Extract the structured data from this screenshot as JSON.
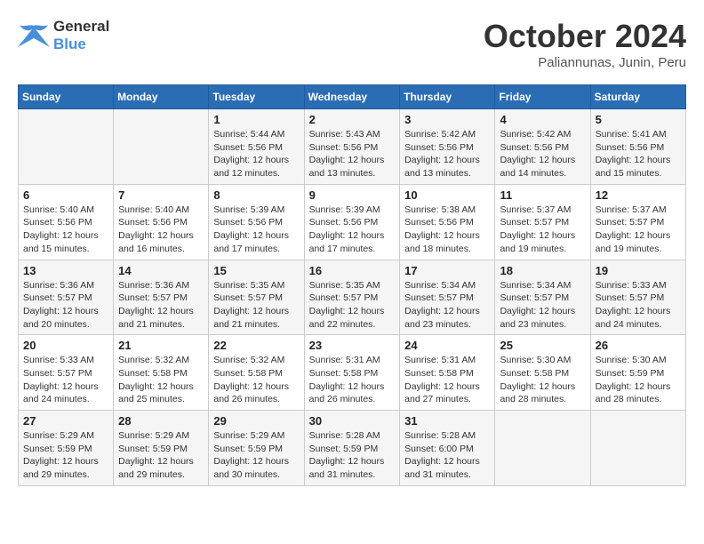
{
  "logo": {
    "line1": "General",
    "line2": "Blue"
  },
  "title": "October 2024",
  "location": "Paliannunas, Junin, Peru",
  "weekdays": [
    "Sunday",
    "Monday",
    "Tuesday",
    "Wednesday",
    "Thursday",
    "Friday",
    "Saturday"
  ],
  "weeks": [
    [
      {
        "day": "",
        "sunrise": "",
        "sunset": "",
        "daylight": ""
      },
      {
        "day": "",
        "sunrise": "",
        "sunset": "",
        "daylight": ""
      },
      {
        "day": "1",
        "sunrise": "Sunrise: 5:44 AM",
        "sunset": "Sunset: 5:56 PM",
        "daylight": "Daylight: 12 hours and 12 minutes."
      },
      {
        "day": "2",
        "sunrise": "Sunrise: 5:43 AM",
        "sunset": "Sunset: 5:56 PM",
        "daylight": "Daylight: 12 hours and 13 minutes."
      },
      {
        "day": "3",
        "sunrise": "Sunrise: 5:42 AM",
        "sunset": "Sunset: 5:56 PM",
        "daylight": "Daylight: 12 hours and 13 minutes."
      },
      {
        "day": "4",
        "sunrise": "Sunrise: 5:42 AM",
        "sunset": "Sunset: 5:56 PM",
        "daylight": "Daylight: 12 hours and 14 minutes."
      },
      {
        "day": "5",
        "sunrise": "Sunrise: 5:41 AM",
        "sunset": "Sunset: 5:56 PM",
        "daylight": "Daylight: 12 hours and 15 minutes."
      }
    ],
    [
      {
        "day": "6",
        "sunrise": "Sunrise: 5:40 AM",
        "sunset": "Sunset: 5:56 PM",
        "daylight": "Daylight: 12 hours and 15 minutes."
      },
      {
        "day": "7",
        "sunrise": "Sunrise: 5:40 AM",
        "sunset": "Sunset: 5:56 PM",
        "daylight": "Daylight: 12 hours and 16 minutes."
      },
      {
        "day": "8",
        "sunrise": "Sunrise: 5:39 AM",
        "sunset": "Sunset: 5:56 PM",
        "daylight": "Daylight: 12 hours and 17 minutes."
      },
      {
        "day": "9",
        "sunrise": "Sunrise: 5:39 AM",
        "sunset": "Sunset: 5:56 PM",
        "daylight": "Daylight: 12 hours and 17 minutes."
      },
      {
        "day": "10",
        "sunrise": "Sunrise: 5:38 AM",
        "sunset": "Sunset: 5:56 PM",
        "daylight": "Daylight: 12 hours and 18 minutes."
      },
      {
        "day": "11",
        "sunrise": "Sunrise: 5:37 AM",
        "sunset": "Sunset: 5:57 PM",
        "daylight": "Daylight: 12 hours and 19 minutes."
      },
      {
        "day": "12",
        "sunrise": "Sunrise: 5:37 AM",
        "sunset": "Sunset: 5:57 PM",
        "daylight": "Daylight: 12 hours and 19 minutes."
      }
    ],
    [
      {
        "day": "13",
        "sunrise": "Sunrise: 5:36 AM",
        "sunset": "Sunset: 5:57 PM",
        "daylight": "Daylight: 12 hours and 20 minutes."
      },
      {
        "day": "14",
        "sunrise": "Sunrise: 5:36 AM",
        "sunset": "Sunset: 5:57 PM",
        "daylight": "Daylight: 12 hours and 21 minutes."
      },
      {
        "day": "15",
        "sunrise": "Sunrise: 5:35 AM",
        "sunset": "Sunset: 5:57 PM",
        "daylight": "Daylight: 12 hours and 21 minutes."
      },
      {
        "day": "16",
        "sunrise": "Sunrise: 5:35 AM",
        "sunset": "Sunset: 5:57 PM",
        "daylight": "Daylight: 12 hours and 22 minutes."
      },
      {
        "day": "17",
        "sunrise": "Sunrise: 5:34 AM",
        "sunset": "Sunset: 5:57 PM",
        "daylight": "Daylight: 12 hours and 23 minutes."
      },
      {
        "day": "18",
        "sunrise": "Sunrise: 5:34 AM",
        "sunset": "Sunset: 5:57 PM",
        "daylight": "Daylight: 12 hours and 23 minutes."
      },
      {
        "day": "19",
        "sunrise": "Sunrise: 5:33 AM",
        "sunset": "Sunset: 5:57 PM",
        "daylight": "Daylight: 12 hours and 24 minutes."
      }
    ],
    [
      {
        "day": "20",
        "sunrise": "Sunrise: 5:33 AM",
        "sunset": "Sunset: 5:57 PM",
        "daylight": "Daylight: 12 hours and 24 minutes."
      },
      {
        "day": "21",
        "sunrise": "Sunrise: 5:32 AM",
        "sunset": "Sunset: 5:58 PM",
        "daylight": "Daylight: 12 hours and 25 minutes."
      },
      {
        "day": "22",
        "sunrise": "Sunrise: 5:32 AM",
        "sunset": "Sunset: 5:58 PM",
        "daylight": "Daylight: 12 hours and 26 minutes."
      },
      {
        "day": "23",
        "sunrise": "Sunrise: 5:31 AM",
        "sunset": "Sunset: 5:58 PM",
        "daylight": "Daylight: 12 hours and 26 minutes."
      },
      {
        "day": "24",
        "sunrise": "Sunrise: 5:31 AM",
        "sunset": "Sunset: 5:58 PM",
        "daylight": "Daylight: 12 hours and 27 minutes."
      },
      {
        "day": "25",
        "sunrise": "Sunrise: 5:30 AM",
        "sunset": "Sunset: 5:58 PM",
        "daylight": "Daylight: 12 hours and 28 minutes."
      },
      {
        "day": "26",
        "sunrise": "Sunrise: 5:30 AM",
        "sunset": "Sunset: 5:59 PM",
        "daylight": "Daylight: 12 hours and 28 minutes."
      }
    ],
    [
      {
        "day": "27",
        "sunrise": "Sunrise: 5:29 AM",
        "sunset": "Sunset: 5:59 PM",
        "daylight": "Daylight: 12 hours and 29 minutes."
      },
      {
        "day": "28",
        "sunrise": "Sunrise: 5:29 AM",
        "sunset": "Sunset: 5:59 PM",
        "daylight": "Daylight: 12 hours and 29 minutes."
      },
      {
        "day": "29",
        "sunrise": "Sunrise: 5:29 AM",
        "sunset": "Sunset: 5:59 PM",
        "daylight": "Daylight: 12 hours and 30 minutes."
      },
      {
        "day": "30",
        "sunrise": "Sunrise: 5:28 AM",
        "sunset": "Sunset: 5:59 PM",
        "daylight": "Daylight: 12 hours and 31 minutes."
      },
      {
        "day": "31",
        "sunrise": "Sunrise: 5:28 AM",
        "sunset": "Sunset: 6:00 PM",
        "daylight": "Daylight: 12 hours and 31 minutes."
      },
      {
        "day": "",
        "sunrise": "",
        "sunset": "",
        "daylight": ""
      },
      {
        "day": "",
        "sunrise": "",
        "sunset": "",
        "daylight": ""
      }
    ]
  ]
}
